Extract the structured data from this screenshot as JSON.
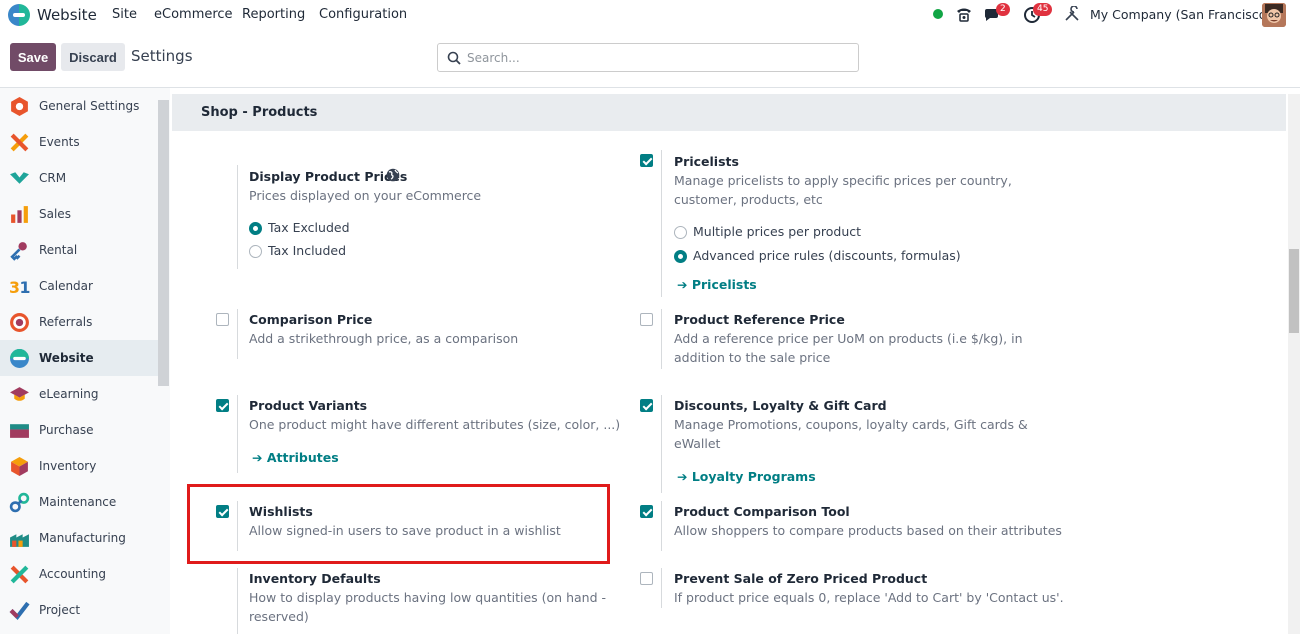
{
  "topnav": {
    "app_name": "Website",
    "menus": [
      "Site",
      "eCommerce",
      "Reporting",
      "Configuration"
    ],
    "messages_badge": "2",
    "activities_badge": "45",
    "company": "My Company (San Francisco)"
  },
  "control": {
    "save_label": "Save",
    "discard_label": "Discard",
    "breadcrumb": "Settings",
    "search_placeholder": "Search..."
  },
  "sidebar": {
    "items": [
      {
        "label": "General Settings",
        "icon": "general-settings-icon"
      },
      {
        "label": "Events",
        "icon": "events-icon"
      },
      {
        "label": "CRM",
        "icon": "crm-icon"
      },
      {
        "label": "Sales",
        "icon": "sales-icon"
      },
      {
        "label": "Rental",
        "icon": "rental-icon"
      },
      {
        "label": "Calendar",
        "icon": "calendar-icon"
      },
      {
        "label": "Referrals",
        "icon": "referrals-icon"
      },
      {
        "label": "Website",
        "icon": "website-icon",
        "active": true
      },
      {
        "label": "eLearning",
        "icon": "elearning-icon"
      },
      {
        "label": "Purchase",
        "icon": "purchase-icon"
      },
      {
        "label": "Inventory",
        "icon": "inventory-icon"
      },
      {
        "label": "Maintenance",
        "icon": "maintenance-icon"
      },
      {
        "label": "Manufacturing",
        "icon": "manufacturing-icon"
      },
      {
        "label": "Accounting",
        "icon": "accounting-icon"
      },
      {
        "label": "Project",
        "icon": "project-icon"
      }
    ]
  },
  "main": {
    "section_title": "Shop - Products",
    "display_prices": {
      "title": "Display Product Prices",
      "desc": "Prices displayed on your eCommerce",
      "options": [
        "Tax Excluded",
        "Tax Included"
      ],
      "selected": "Tax Excluded"
    },
    "pricelists": {
      "title": "Pricelists",
      "checked": true,
      "desc_line1": "Manage pricelists to apply specific prices per country,",
      "desc_line2": "customer, products, etc",
      "options": [
        "Multiple prices per product",
        "Advanced price rules (discounts, formulas)"
      ],
      "selected": "Advanced price rules (discounts, formulas)",
      "link": "Pricelists"
    },
    "comparison_price": {
      "title": "Comparison Price",
      "checked": false,
      "desc": "Add a strikethrough price, as a comparison"
    },
    "product_reference_price": {
      "title": "Product Reference Price",
      "checked": false,
      "desc_line1": "Add a reference price per UoM on products (i.e $/kg), in",
      "desc_line2": "addition to the sale price"
    },
    "product_variants": {
      "title": "Product Variants",
      "checked": true,
      "desc": "One product might have different attributes (size, color, ...)",
      "link": "Attributes"
    },
    "discounts_loyalty": {
      "title": "Discounts, Loyalty & Gift Card",
      "checked": true,
      "desc_line1": "Manage Promotions, coupons, loyalty cards, Gift cards &",
      "desc_line2": "eWallet",
      "link": "Loyalty Programs"
    },
    "wishlists": {
      "title": "Wishlists",
      "checked": true,
      "desc": "Allow signed-in users to save product in a wishlist"
    },
    "product_comparison": {
      "title": "Product Comparison Tool",
      "checked": true,
      "desc": "Allow shoppers to compare products based on their attributes"
    },
    "inventory_defaults": {
      "title": "Inventory Defaults",
      "desc_line1": "How to display products having low quantities (on hand -",
      "desc_line2": "reserved)"
    },
    "prevent_zero_price": {
      "title": "Prevent Sale of Zero Priced Product",
      "checked": false,
      "desc": "If product price equals 0, replace 'Add to Cart' by 'Contact us'."
    }
  },
  "colors": {
    "brand": "#714b67",
    "accent": "#017e84",
    "highlight": "#e01b1b"
  }
}
